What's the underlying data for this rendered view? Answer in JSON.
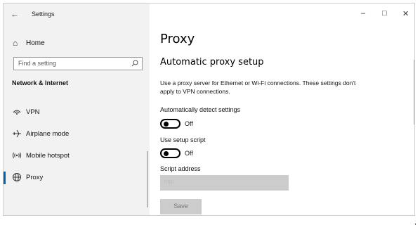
{
  "window": {
    "title": "Settings"
  },
  "icons": {
    "back": "arrow-left-icon",
    "home": "home-icon",
    "search": "search-icon",
    "vpn": "vpn-icon",
    "airplane": "airplane-icon",
    "hotspot": "hotspot-icon",
    "proxy": "globe-icon",
    "minimize": "minimize-icon",
    "maximize": "maximize-icon",
    "close": "close-icon"
  },
  "glyphs": {
    "back": "←",
    "home": "⌂",
    "minimize": "–",
    "maximize": "□",
    "close": "✕"
  },
  "sidebar": {
    "home_label": "Home",
    "search_placeholder": "Find a setting",
    "section": "Network & Internet",
    "items": [
      {
        "label": "VPN"
      },
      {
        "label": "Airplane mode"
      },
      {
        "label": "Mobile hotspot"
      },
      {
        "label": "Proxy",
        "active": true
      }
    ]
  },
  "main": {
    "title": "Proxy",
    "subheading": "Automatic proxy setup",
    "description": "Use a proxy server for Ethernet or Wi-Fi connections. These settings don't apply to VPN connections.",
    "auto_detect": {
      "label": "Automatically detect settings",
      "state": "Off"
    },
    "setup_script": {
      "label": "Use setup script",
      "state": "Off"
    },
    "script_address": {
      "label": "Script address",
      "value": "http"
    },
    "save_label": "Save"
  },
  "colors": {
    "accent": "#0063b1",
    "sidebar_bg": "#f2f2f2",
    "disabled_bg": "#cccccc"
  },
  "trailing_mark": ","
}
